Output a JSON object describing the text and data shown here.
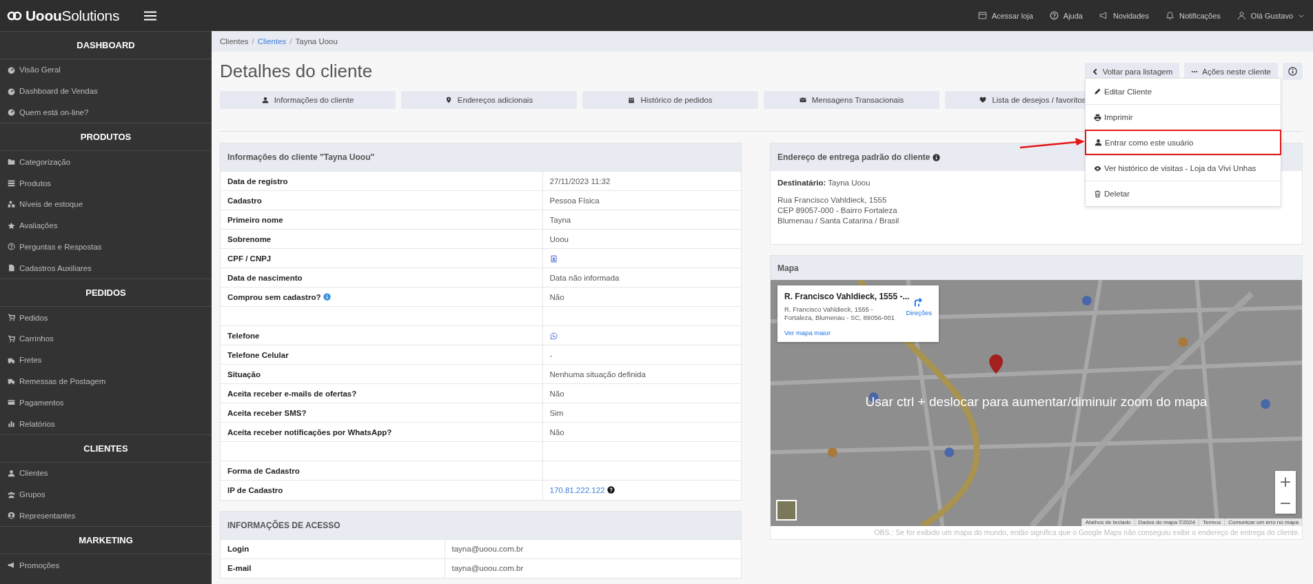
{
  "topbar": {
    "logo": "**Uoou**Solutions",
    "links": [
      "Acessar loja",
      "Ajuda",
      "Novidades",
      "Notificações"
    ],
    "user": "Olá Gustavo"
  },
  "sidebar": {
    "sections": [
      {
        "title": "DASHBOARD",
        "items": [
          "Visão Geral",
          "Dashboard de Vendas",
          "Quem está on-line?"
        ]
      },
      {
        "title": "PRODUTOS",
        "items": [
          "Categorização",
          "Produtos",
          "Níveis de estoque",
          "Avaliações",
          "Perguntas e Respostas",
          "Cadastros Auxiliares"
        ]
      },
      {
        "title": "PEDIDOS",
        "items": [
          "Pedidos",
          "Carrinhos",
          "Fretes",
          "Remessas de Postagem",
          "Pagamentos",
          "Relatórios"
        ]
      },
      {
        "title": "CLIENTES",
        "items": [
          "Clientes",
          "Grupos",
          "Representantes"
        ]
      },
      {
        "title": "MARKETING",
        "items": [
          "Promoções"
        ]
      }
    ]
  },
  "breadcrumb_separator": "/",
  "breadcrumb": [
    {
      "label": "Clientes",
      "link": false
    },
    {
      "label": "Clientes",
      "link": true
    },
    {
      "label": "Tayna Uoou",
      "link": false
    }
  ],
  "page_title": "Detalhes do cliente",
  "header_buttons": [
    "Voltar para listagem",
    "Ações neste cliente"
  ],
  "tabs": [
    "Informações do cliente",
    "Endereços adicionais",
    "Histórico de pedidos",
    "Mensagens Transacionais",
    "Lista de desejos / favoritos"
  ],
  "actions_menu": [
    {
      "label": "Editar Cliente",
      "highlighted": false
    },
    {
      "label": "Imprimir",
      "highlighted": false
    },
    {
      "label": "Entrar como este usuário",
      "highlighted": true
    },
    {
      "label": "Ver histórico de visitas - Loja da Vivi Unhas",
      "highlighted": false
    },
    {
      "label": "Deletar",
      "highlighted": false
    }
  ],
  "client_info": {
    "title": "Informações do cliente \"Tayna Uoou\"",
    "rows": [
      {
        "kind": "text",
        "label": "Data de registro",
        "value": "27/11/2023 11:32"
      },
      {
        "kind": "text",
        "label": "Cadastro",
        "value": "Pessoa Física"
      },
      {
        "kind": "text",
        "label": "Primeiro nome",
        "value": "Tayna"
      },
      {
        "kind": "text",
        "label": "Sobrenome",
        "value": "Uoou"
      },
      {
        "kind": "id",
        "label": "CPF / CNPJ"
      },
      {
        "kind": "text",
        "label": "Data de nascimento",
        "value": "Data não informada"
      },
      {
        "kind": "text",
        "label": "Comprou sem cadastro?",
        "hint": true,
        "value": "Não"
      },
      {
        "kind": "spacer"
      },
      {
        "kind": "phone",
        "label": "Telefone"
      },
      {
        "kind": "text",
        "label": "Telefone Celular",
        "value": "-"
      },
      {
        "kind": "text",
        "label": "Situação",
        "value": "Nenhuma situação definida"
      },
      {
        "kind": "text",
        "label": "Aceita receber e-mails de ofertas?",
        "value": "Não"
      },
      {
        "kind": "text",
        "label": "Aceita receber SMS?",
        "value": "Sim"
      },
      {
        "kind": "text",
        "label": "Aceita receber notificações por WhatsApp?",
        "value": "Não"
      },
      {
        "kind": "spacer"
      },
      {
        "kind": "text",
        "label": "Forma de Cadastro"
      },
      {
        "kind": "link",
        "label": "IP de Cadastro",
        "value": "170.81.222.122"
      }
    ]
  },
  "access_info": {
    "title": "INFORMAÇÕES DE ACESSO",
    "rows": [
      {
        "kind": "text",
        "label": "Login",
        "value": "tayna@uoou.com.br"
      },
      {
        "kind": "text",
        "label": "E-mail",
        "value": "tayna@uoou.com.br"
      }
    ]
  },
  "delivery_address": {
    "title": "Endereço de entrega padrão do cliente",
    "recipient": "**Destinatário:** Tayna Uoou",
    "lines": [
      "Rua Francisco Vahldieck, 1555",
      "CEP 89057-000 - Bairro Fortaleza",
      "Blumenau / Santa Catarina / Brasil"
    ]
  },
  "map": {
    "title": "Mapa",
    "place_card": {
      "title": "R. Francisco Vahldieck, 1555 -...",
      "address_lines": [
        "R. Francisco Vahldieck, 1555 -",
        "Fortaleza, Blumenau - SC, 89056-001"
      ],
      "directions": "Direções",
      "larger_map": "Ver mapa maior"
    },
    "overlay_hint": "Usar ctrl + deslocar para aumentar/diminuir zoom do mapa",
    "zoom_in": "+",
    "zoom_out": "−",
    "attribution": [
      "Atalhos de teclado",
      "Dados do mapa ©2024",
      "Termos",
      "Comunicar um erro no mapa"
    ],
    "note": "OBS.: Se for exibido um mapa do mundo, então significa que o Google Maps não conseguiu exibir o endereço de entrega do cliente."
  }
}
